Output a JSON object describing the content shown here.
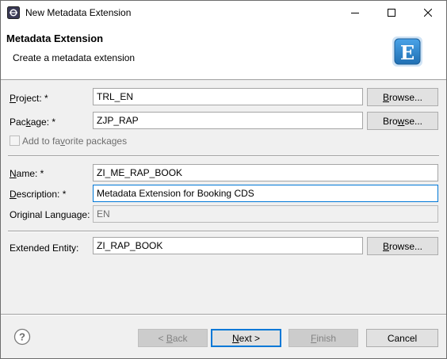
{
  "window": {
    "title": "New Metadata Extension",
    "minimize_icon": "minimize-icon",
    "maximize_icon": "maximize-icon",
    "close_icon": "close-icon"
  },
  "banner": {
    "title": "Metadata Extension",
    "description": "Create a metadata extension",
    "logo_letter": "E"
  },
  "form": {
    "project": {
      "label_pre": "",
      "label_u": "P",
      "label_post": "roject: *",
      "value": "TRL_EN",
      "browse_pre": "",
      "browse_u": "B",
      "browse_post": "rowse..."
    },
    "package": {
      "label_pre": "Pac",
      "label_u": "k",
      "label_post": "age: *",
      "value": "ZJP_RAP",
      "browse_pre": "Bro",
      "browse_u": "w",
      "browse_post": "se..."
    },
    "favorite": {
      "label_pre": "Add to fa",
      "label_u": "v",
      "label_post": "orite packages",
      "checked": false
    },
    "name": {
      "label_pre": "",
      "label_u": "N",
      "label_post": "ame: *",
      "value": "ZI_ME_RAP_BOOK"
    },
    "description": {
      "label_pre": "",
      "label_u": "D",
      "label_post": "escription: *",
      "value": "Metadata Extension for Booking CDS"
    },
    "original_language": {
      "label": "Original Language:",
      "value": "EN"
    },
    "extended_entity": {
      "label": "Extended Entity:",
      "value": "ZI_RAP_BOOK",
      "browse_pre": "",
      "browse_u": "B",
      "browse_post": "rowse..."
    }
  },
  "footer": {
    "help_icon": "help-icon",
    "back": {
      "pre": "< ",
      "u": "B",
      "post": "ack"
    },
    "next": {
      "pre": "",
      "u": "N",
      "post": "ext >"
    },
    "finish": {
      "pre": "",
      "u": "F",
      "post": "inish"
    },
    "cancel": "Cancel"
  },
  "colors": {
    "accent": "#0078d7",
    "dialog_bg": "#f0f0f0",
    "logo_blue": "#2a7fc5"
  }
}
